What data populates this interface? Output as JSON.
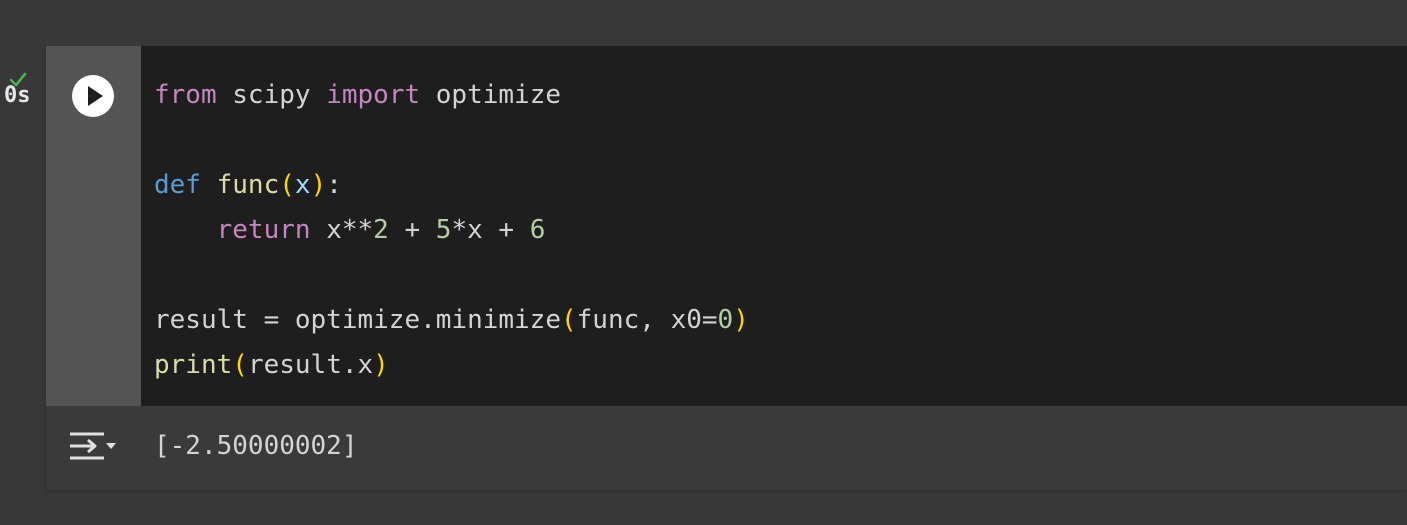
{
  "cell_status": {
    "icon": "check-icon",
    "exec_time": "0s",
    "status_color": "#4caf50"
  },
  "run_button": {
    "icon": "play-icon"
  },
  "code": {
    "lines": [
      [
        {
          "t": "from",
          "c": "kw"
        },
        {
          "t": " scipy ",
          "c": "plain"
        },
        {
          "t": "import",
          "c": "kw"
        },
        {
          "t": " optimize",
          "c": "plain"
        }
      ],
      [],
      [
        {
          "t": "def",
          "c": "def"
        },
        {
          "t": " ",
          "c": "plain"
        },
        {
          "t": "func",
          "c": "fn"
        },
        {
          "t": "(",
          "c": "paren"
        },
        {
          "t": "x",
          "c": "param"
        },
        {
          "t": ")",
          "c": "paren"
        },
        {
          "t": ":",
          "c": "plain"
        }
      ],
      [
        {
          "t": "    ",
          "c": "plain"
        },
        {
          "t": "return",
          "c": "kw"
        },
        {
          "t": " x**",
          "c": "plain"
        },
        {
          "t": "2",
          "c": "num"
        },
        {
          "t": " + ",
          "c": "plain"
        },
        {
          "t": "5",
          "c": "num"
        },
        {
          "t": "*x + ",
          "c": "plain"
        },
        {
          "t": "6",
          "c": "num"
        }
      ],
      [],
      [
        {
          "t": "result = optimize.minimize",
          "c": "plain"
        },
        {
          "t": "(",
          "c": "paren"
        },
        {
          "t": "func, x0=",
          "c": "plain"
        },
        {
          "t": "0",
          "c": "num"
        },
        {
          "t": ")",
          "c": "paren"
        }
      ],
      [
        {
          "t": "print",
          "c": "fn"
        },
        {
          "t": "(",
          "c": "paren"
        },
        {
          "t": "result.x",
          "c": "plain"
        },
        {
          "t": ")",
          "c": "paren"
        }
      ]
    ]
  },
  "output": {
    "toggle_icon": "output-toggle-icon",
    "text": "[-2.50000002]"
  },
  "colors": {
    "background": "#383838",
    "gutter": "#545454",
    "editor": "#1e1e1e",
    "keyword": "#c586c0",
    "def_keyword": "#569cd6",
    "function": "#dcdcaa",
    "parameter": "#9cdcfe",
    "number": "#b5cea8",
    "bracket": "#ffd700"
  }
}
